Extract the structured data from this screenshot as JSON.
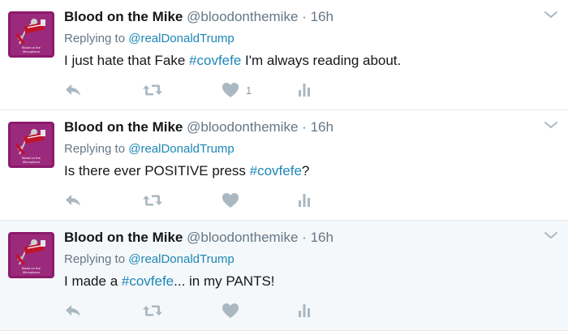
{
  "colors": {
    "text": "#14171a",
    "secondary": "#657786",
    "link": "#1d87b8",
    "icon": "#aab8c2",
    "divider": "#e1e8ed",
    "hover_bg": "#f5f8fa",
    "avatar_bg": "#8b1a6b"
  },
  "icons": {
    "reply": "reply-arrow-icon",
    "retweet": "retweet-icon",
    "like": "heart-icon",
    "analytics": "analytics-bars-icon",
    "more": "chevron-down-icon"
  },
  "avatar_text": {
    "line1": "Blood on the",
    "line2": "Microphone"
  },
  "tweets": [
    {
      "name": "Blood on the Mike",
      "handle": "@bloodonthemike",
      "separator": "·",
      "time": "16h",
      "replying_prefix": "Replying to",
      "replying_to": "@realDonaldTrump",
      "text_before": "I just hate that Fake ",
      "hashtag": "#covfefe",
      "text_after": " I'm always reading about.",
      "like_count": "1"
    },
    {
      "name": "Blood on the Mike",
      "handle": "@bloodonthemike",
      "separator": "·",
      "time": "16h",
      "replying_prefix": "Replying to",
      "replying_to": "@realDonaldTrump",
      "text_before": "Is there ever POSITIVE press ",
      "hashtag": "#covfefe",
      "text_after": "?",
      "like_count": ""
    },
    {
      "name": "Blood on the Mike",
      "handle": "@bloodonthemike",
      "separator": "·",
      "time": "16h",
      "replying_prefix": "Replying to",
      "replying_to": "@realDonaldTrump",
      "text_before": "I made a ",
      "hashtag": "#covfefe",
      "text_after": "... in my PANTS!",
      "like_count": ""
    }
  ]
}
